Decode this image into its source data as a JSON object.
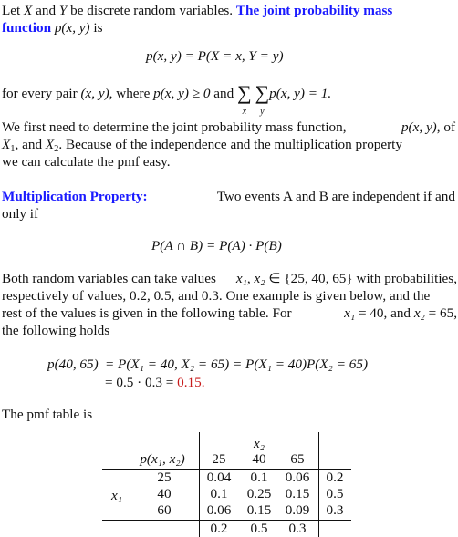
{
  "intro": {
    "p1_pre": "Let ",
    "var_X": "X",
    "p1_and": " and ",
    "var_Y": "Y",
    "p1_post": " be discrete random variables. ",
    "highlight_1": "The joint probability mass",
    "highlight_2": "function",
    "p1_func": "p(x, y)",
    "p1_is": " is"
  },
  "eq1": "p(x, y) = P(X = x, Y = y)",
  "condition": {
    "pre": "for every pair ",
    "pair": "(x, y)",
    "mid": ", where ",
    "ineq": "p(x, y) ≥ 0",
    "and": " and ",
    "sum_sym": "∑",
    "sub_x": "x",
    "sub_y": "y",
    "sum_expr": "p(x, y) = 1."
  },
  "para2": {
    "line1_pre": "We first need to determine the joint probability mass function, ",
    "line1_func": "p(x, y)",
    "line1_post": ", of",
    "X1": "X",
    "X1_sub": "1",
    "line2_mid": ", and ",
    "X2": "X",
    "X2_sub": "2",
    "line2_post": ". Because of the independence and the multiplication property",
    "line3": "we can calculate the pmf easy."
  },
  "mult": {
    "title": "Multiplication Property:",
    "text_1": "Two events A and B are independent if and",
    "text_2": "only if",
    "eq": "P(A ∩ B) = P(A) · P(B)"
  },
  "para3": {
    "l1_pre": "Both random variables can take values ",
    "l1_vars": "x₁, x₂",
    "l1_in": " ∈ {25, 40, 65} with probabilities,",
    "l2": "respectively of values, 0.2, 0.5, and 0.3. One example is given below, and the",
    "l3_pre": "rest of the values is given in the following table. For ",
    "l3_x1": "x₁",
    "l3_eq1": " = 40, and ",
    "l3_x2": "x₂",
    "l3_eq2": " = 65,",
    "l4": "the following holds"
  },
  "example": {
    "lhs": "p(40, 65)",
    "line1": "= P(X₁ = 40, X₂ = 65) = P(X₁ = 40)P(X₂ = 65)",
    "line2_pre": "= 0.5 · 0.3 = ",
    "result": "0.15."
  },
  "table_intro": "The pmf table is",
  "table": {
    "col_var": "x₂",
    "corner": "p(x₁, x₂)",
    "col_headers": [
      "25",
      "40",
      "65"
    ],
    "row_var": "x₁",
    "row_headers": [
      "25",
      "40",
      "60"
    ],
    "rows": [
      [
        "0.04",
        "0.1",
        "0.06"
      ],
      [
        "0.1",
        "0.25",
        "0.15"
      ],
      [
        "0.06",
        "0.15",
        "0.09"
      ]
    ],
    "row_marginals": [
      "0.2",
      "0.5",
      "0.3"
    ],
    "col_marginals": [
      "0.2",
      "0.5",
      "0.3"
    ]
  },
  "colors": {
    "highlight": "#1a1aff",
    "result": "#c81c1c"
  }
}
